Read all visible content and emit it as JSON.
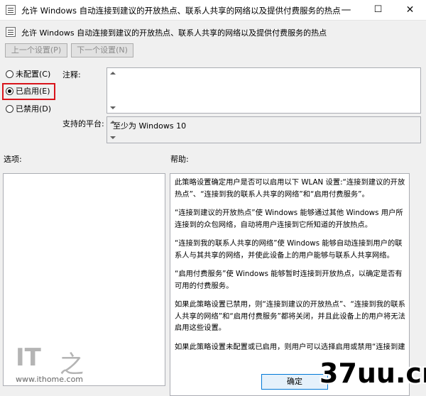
{
  "window": {
    "title": "允许 Windows 自动连接到建议的开放热点、联系人共享的网络以及提供付费服务的热点",
    "minimize": "—",
    "maximize": "☐",
    "close": "✕"
  },
  "header": {
    "title": "允许 Windows 自动连接到建议的开放热点、联系人共享的网络以及提供付费服务的热点"
  },
  "toolbar": {
    "prev_setting": "上一个设置(P)",
    "next_setting": "下一个设置(N)"
  },
  "state_options": [
    {
      "label": "未配置(C)",
      "selected": false
    },
    {
      "label": "已启用(E)",
      "selected": true
    },
    {
      "label": "已禁用(D)",
      "selected": false
    }
  ],
  "comment": {
    "label": "注释:",
    "value": ""
  },
  "supported_on": {
    "label": "支持的平台:",
    "value": "至少为 Windows 10"
  },
  "options_section": {
    "label": "选项:"
  },
  "help_section": {
    "label": "帮助:",
    "paragraphs": [
      "此策略设置确定用户是否可以启用以下 WLAN 设置:“连接到建议的开放热点”、“连接到我的联系人共享的网络”和“启用付费服务”。",
      "“连接到建议的开放热点”使 Windows 能够通过其他 Windows 用户所连接到的众包网络，自动将用户连接到它所知道的开放热点。",
      "“连接到我的联系人共享的网络”使 Windows 能够自动连接到用户的联系人与其共享的网络，并使此设备上的用户能够与联系人共享网络。",
      "“启用付费服务”使 Windows 能够暂时连接到开放热点，以确定是否有可用的付费服务。",
      "如果此策略设置已禁用，则“连接到建议的开放热点”、“连接到我的联系人共享的网络”和“启用付费服务”都将关闭，并且此设备上的用户将无法启用这些设置。",
      "如果此策略设置未配置或已启用，则用户可以选择启用或禁用“连接到建"
    ]
  },
  "footer": {
    "ok": "确定"
  },
  "watermarks": {
    "left_logo": "IT",
    "left_glyph": "之",
    "left_url": "www.ithome.com",
    "right": "37uu.cn"
  },
  "colors": {
    "highlight_border": "#d9141b",
    "ok_button_border": "#0078d7"
  }
}
